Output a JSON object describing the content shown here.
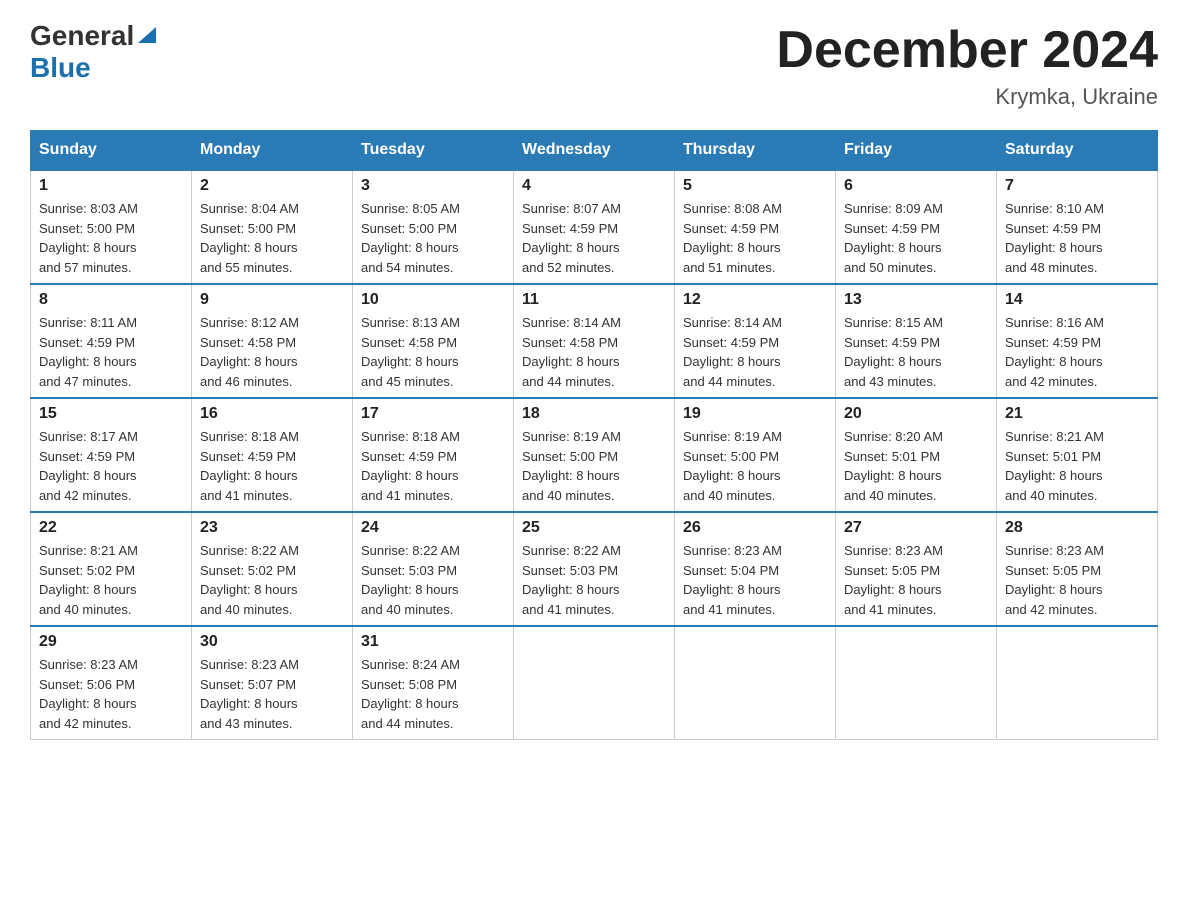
{
  "header": {
    "logo_general": "General",
    "logo_blue": "Blue",
    "month_title": "December 2024",
    "location": "Krymka, Ukraine"
  },
  "weekdays": [
    "Sunday",
    "Monday",
    "Tuesday",
    "Wednesday",
    "Thursday",
    "Friday",
    "Saturday"
  ],
  "weeks": [
    [
      {
        "day": "1",
        "sunrise": "8:03 AM",
        "sunset": "5:00 PM",
        "daylight": "8 hours and 57 minutes."
      },
      {
        "day": "2",
        "sunrise": "8:04 AM",
        "sunset": "5:00 PM",
        "daylight": "8 hours and 55 minutes."
      },
      {
        "day": "3",
        "sunrise": "8:05 AM",
        "sunset": "5:00 PM",
        "daylight": "8 hours and 54 minutes."
      },
      {
        "day": "4",
        "sunrise": "8:07 AM",
        "sunset": "4:59 PM",
        "daylight": "8 hours and 52 minutes."
      },
      {
        "day": "5",
        "sunrise": "8:08 AM",
        "sunset": "4:59 PM",
        "daylight": "8 hours and 51 minutes."
      },
      {
        "day": "6",
        "sunrise": "8:09 AM",
        "sunset": "4:59 PM",
        "daylight": "8 hours and 50 minutes."
      },
      {
        "day": "7",
        "sunrise": "8:10 AM",
        "sunset": "4:59 PM",
        "daylight": "8 hours and 48 minutes."
      }
    ],
    [
      {
        "day": "8",
        "sunrise": "8:11 AM",
        "sunset": "4:59 PM",
        "daylight": "8 hours and 47 minutes."
      },
      {
        "day": "9",
        "sunrise": "8:12 AM",
        "sunset": "4:58 PM",
        "daylight": "8 hours and 46 minutes."
      },
      {
        "day": "10",
        "sunrise": "8:13 AM",
        "sunset": "4:58 PM",
        "daylight": "8 hours and 45 minutes."
      },
      {
        "day": "11",
        "sunrise": "8:14 AM",
        "sunset": "4:58 PM",
        "daylight": "8 hours and 44 minutes."
      },
      {
        "day": "12",
        "sunrise": "8:14 AM",
        "sunset": "4:59 PM",
        "daylight": "8 hours and 44 minutes."
      },
      {
        "day": "13",
        "sunrise": "8:15 AM",
        "sunset": "4:59 PM",
        "daylight": "8 hours and 43 minutes."
      },
      {
        "day": "14",
        "sunrise": "8:16 AM",
        "sunset": "4:59 PM",
        "daylight": "8 hours and 42 minutes."
      }
    ],
    [
      {
        "day": "15",
        "sunrise": "8:17 AM",
        "sunset": "4:59 PM",
        "daylight": "8 hours and 42 minutes."
      },
      {
        "day": "16",
        "sunrise": "8:18 AM",
        "sunset": "4:59 PM",
        "daylight": "8 hours and 41 minutes."
      },
      {
        "day": "17",
        "sunrise": "8:18 AM",
        "sunset": "4:59 PM",
        "daylight": "8 hours and 41 minutes."
      },
      {
        "day": "18",
        "sunrise": "8:19 AM",
        "sunset": "5:00 PM",
        "daylight": "8 hours and 40 minutes."
      },
      {
        "day": "19",
        "sunrise": "8:19 AM",
        "sunset": "5:00 PM",
        "daylight": "8 hours and 40 minutes."
      },
      {
        "day": "20",
        "sunrise": "8:20 AM",
        "sunset": "5:01 PM",
        "daylight": "8 hours and 40 minutes."
      },
      {
        "day": "21",
        "sunrise": "8:21 AM",
        "sunset": "5:01 PM",
        "daylight": "8 hours and 40 minutes."
      }
    ],
    [
      {
        "day": "22",
        "sunrise": "8:21 AM",
        "sunset": "5:02 PM",
        "daylight": "8 hours and 40 minutes."
      },
      {
        "day": "23",
        "sunrise": "8:22 AM",
        "sunset": "5:02 PM",
        "daylight": "8 hours and 40 minutes."
      },
      {
        "day": "24",
        "sunrise": "8:22 AM",
        "sunset": "5:03 PM",
        "daylight": "8 hours and 40 minutes."
      },
      {
        "day": "25",
        "sunrise": "8:22 AM",
        "sunset": "5:03 PM",
        "daylight": "8 hours and 41 minutes."
      },
      {
        "day": "26",
        "sunrise": "8:23 AM",
        "sunset": "5:04 PM",
        "daylight": "8 hours and 41 minutes."
      },
      {
        "day": "27",
        "sunrise": "8:23 AM",
        "sunset": "5:05 PM",
        "daylight": "8 hours and 41 minutes."
      },
      {
        "day": "28",
        "sunrise": "8:23 AM",
        "sunset": "5:05 PM",
        "daylight": "8 hours and 42 minutes."
      }
    ],
    [
      {
        "day": "29",
        "sunrise": "8:23 AM",
        "sunset": "5:06 PM",
        "daylight": "8 hours and 42 minutes."
      },
      {
        "day": "30",
        "sunrise": "8:23 AM",
        "sunset": "5:07 PM",
        "daylight": "8 hours and 43 minutes."
      },
      {
        "day": "31",
        "sunrise": "8:24 AM",
        "sunset": "5:08 PM",
        "daylight": "8 hours and 44 minutes."
      },
      null,
      null,
      null,
      null
    ]
  ],
  "labels": {
    "sunrise": "Sunrise:",
    "sunset": "Sunset:",
    "daylight": "Daylight:"
  }
}
